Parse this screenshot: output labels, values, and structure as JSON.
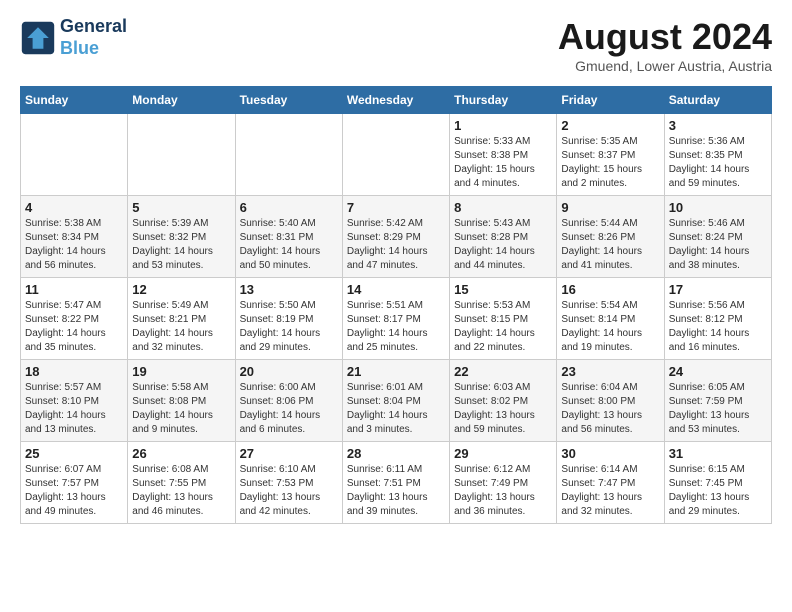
{
  "header": {
    "logo_line1": "General",
    "logo_line2": "Blue",
    "month_year": "August 2024",
    "location": "Gmuend, Lower Austria, Austria"
  },
  "days_of_week": [
    "Sunday",
    "Monday",
    "Tuesday",
    "Wednesday",
    "Thursday",
    "Friday",
    "Saturday"
  ],
  "weeks": [
    [
      {
        "day": "",
        "info": ""
      },
      {
        "day": "",
        "info": ""
      },
      {
        "day": "",
        "info": ""
      },
      {
        "day": "",
        "info": ""
      },
      {
        "day": "1",
        "info": "Sunrise: 5:33 AM\nSunset: 8:38 PM\nDaylight: 15 hours\nand 4 minutes."
      },
      {
        "day": "2",
        "info": "Sunrise: 5:35 AM\nSunset: 8:37 PM\nDaylight: 15 hours\nand 2 minutes."
      },
      {
        "day": "3",
        "info": "Sunrise: 5:36 AM\nSunset: 8:35 PM\nDaylight: 14 hours\nand 59 minutes."
      }
    ],
    [
      {
        "day": "4",
        "info": "Sunrise: 5:38 AM\nSunset: 8:34 PM\nDaylight: 14 hours\nand 56 minutes."
      },
      {
        "day": "5",
        "info": "Sunrise: 5:39 AM\nSunset: 8:32 PM\nDaylight: 14 hours\nand 53 minutes."
      },
      {
        "day": "6",
        "info": "Sunrise: 5:40 AM\nSunset: 8:31 PM\nDaylight: 14 hours\nand 50 minutes."
      },
      {
        "day": "7",
        "info": "Sunrise: 5:42 AM\nSunset: 8:29 PM\nDaylight: 14 hours\nand 47 minutes."
      },
      {
        "day": "8",
        "info": "Sunrise: 5:43 AM\nSunset: 8:28 PM\nDaylight: 14 hours\nand 44 minutes."
      },
      {
        "day": "9",
        "info": "Sunrise: 5:44 AM\nSunset: 8:26 PM\nDaylight: 14 hours\nand 41 minutes."
      },
      {
        "day": "10",
        "info": "Sunrise: 5:46 AM\nSunset: 8:24 PM\nDaylight: 14 hours\nand 38 minutes."
      }
    ],
    [
      {
        "day": "11",
        "info": "Sunrise: 5:47 AM\nSunset: 8:22 PM\nDaylight: 14 hours\nand 35 minutes."
      },
      {
        "day": "12",
        "info": "Sunrise: 5:49 AM\nSunset: 8:21 PM\nDaylight: 14 hours\nand 32 minutes."
      },
      {
        "day": "13",
        "info": "Sunrise: 5:50 AM\nSunset: 8:19 PM\nDaylight: 14 hours\nand 29 minutes."
      },
      {
        "day": "14",
        "info": "Sunrise: 5:51 AM\nSunset: 8:17 PM\nDaylight: 14 hours\nand 25 minutes."
      },
      {
        "day": "15",
        "info": "Sunrise: 5:53 AM\nSunset: 8:15 PM\nDaylight: 14 hours\nand 22 minutes."
      },
      {
        "day": "16",
        "info": "Sunrise: 5:54 AM\nSunset: 8:14 PM\nDaylight: 14 hours\nand 19 minutes."
      },
      {
        "day": "17",
        "info": "Sunrise: 5:56 AM\nSunset: 8:12 PM\nDaylight: 14 hours\nand 16 minutes."
      }
    ],
    [
      {
        "day": "18",
        "info": "Sunrise: 5:57 AM\nSunset: 8:10 PM\nDaylight: 14 hours\nand 13 minutes."
      },
      {
        "day": "19",
        "info": "Sunrise: 5:58 AM\nSunset: 8:08 PM\nDaylight: 14 hours\nand 9 minutes."
      },
      {
        "day": "20",
        "info": "Sunrise: 6:00 AM\nSunset: 8:06 PM\nDaylight: 14 hours\nand 6 minutes."
      },
      {
        "day": "21",
        "info": "Sunrise: 6:01 AM\nSunset: 8:04 PM\nDaylight: 14 hours\nand 3 minutes."
      },
      {
        "day": "22",
        "info": "Sunrise: 6:03 AM\nSunset: 8:02 PM\nDaylight: 13 hours\nand 59 minutes."
      },
      {
        "day": "23",
        "info": "Sunrise: 6:04 AM\nSunset: 8:00 PM\nDaylight: 13 hours\nand 56 minutes."
      },
      {
        "day": "24",
        "info": "Sunrise: 6:05 AM\nSunset: 7:59 PM\nDaylight: 13 hours\nand 53 minutes."
      }
    ],
    [
      {
        "day": "25",
        "info": "Sunrise: 6:07 AM\nSunset: 7:57 PM\nDaylight: 13 hours\nand 49 minutes."
      },
      {
        "day": "26",
        "info": "Sunrise: 6:08 AM\nSunset: 7:55 PM\nDaylight: 13 hours\nand 46 minutes."
      },
      {
        "day": "27",
        "info": "Sunrise: 6:10 AM\nSunset: 7:53 PM\nDaylight: 13 hours\nand 42 minutes."
      },
      {
        "day": "28",
        "info": "Sunrise: 6:11 AM\nSunset: 7:51 PM\nDaylight: 13 hours\nand 39 minutes."
      },
      {
        "day": "29",
        "info": "Sunrise: 6:12 AM\nSunset: 7:49 PM\nDaylight: 13 hours\nand 36 minutes."
      },
      {
        "day": "30",
        "info": "Sunrise: 6:14 AM\nSunset: 7:47 PM\nDaylight: 13 hours\nand 32 minutes."
      },
      {
        "day": "31",
        "info": "Sunrise: 6:15 AM\nSunset: 7:45 PM\nDaylight: 13 hours\nand 29 minutes."
      }
    ]
  ]
}
